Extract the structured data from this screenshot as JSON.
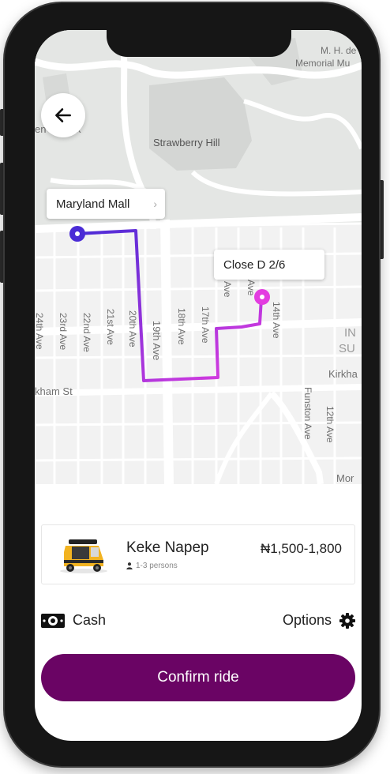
{
  "map": {
    "labels": {
      "memorial_line1": "M. H. de Yo",
      "memorial_line2": "Memorial Mu",
      "park": "en G  Park",
      "strawberry_hill": "Strawberry Hill",
      "kirkham_st_left": "kham St",
      "kirkham_st_right": "Kirkha",
      "inner_sunset": "IN",
      "inner_sunset2": "SU",
      "ave_24": "24th Ave",
      "ave_23": "23rd Ave",
      "ave_22": "22nd Ave",
      "ave_21": "21st Ave",
      "ave_20": "20th Ave",
      "ave_19": "19th Ave",
      "ave_18": "18th Ave",
      "ave_17": "17th Ave",
      "ave_16": "Ave",
      "ave_15": "Ave",
      "ave_14": "14th Ave",
      "ave_12": "12th Ave",
      "funston": "Funston Ave",
      "mor": "Mor"
    },
    "pickup_label": "Maryland Mall",
    "dropoff_label": "Close D 2/6",
    "route_colors": {
      "start": "#4a2bd6",
      "end": "#e33ce0"
    }
  },
  "ride": {
    "name": "Keke Napep",
    "capacity": "1-3 persons",
    "price": "₦1,500-1,800",
    "image": "keke-tricycle"
  },
  "payment": {
    "method": "Cash",
    "options_label": "Options"
  },
  "confirm_label": "Confirm ride",
  "colors": {
    "accent": "#6a0464",
    "background": "#ffffff"
  }
}
